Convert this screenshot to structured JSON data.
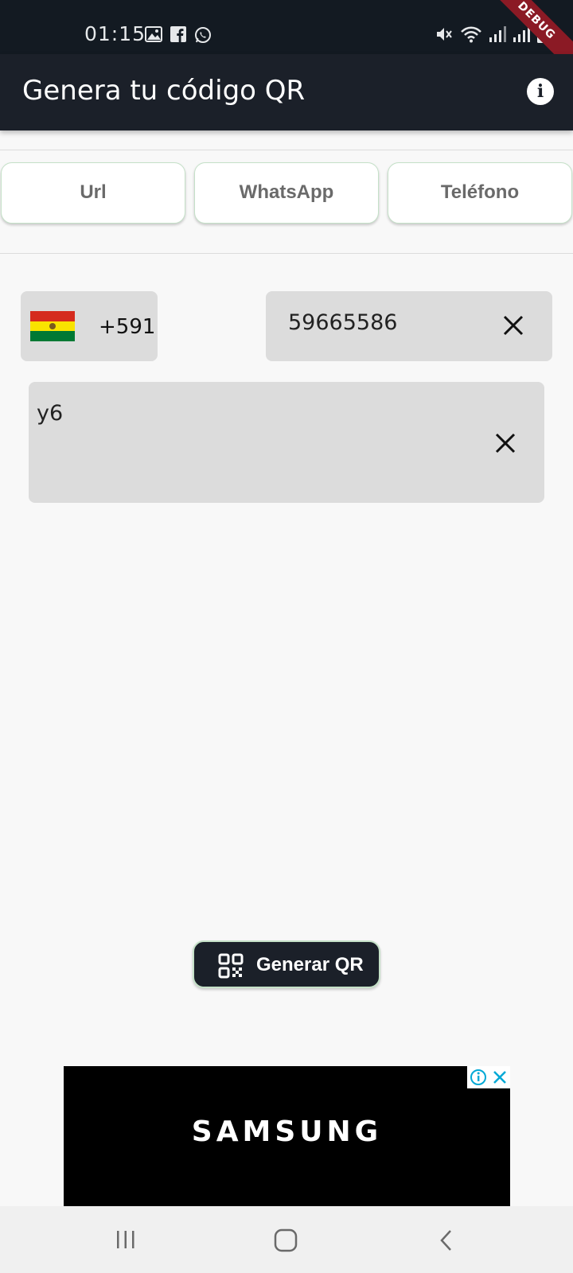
{
  "status_bar": {
    "time": "01:15",
    "left_icons": [
      "image-icon",
      "facebook-icon",
      "whatsapp-icon"
    ],
    "right_icons": [
      "mute-icon",
      "wifi-icon",
      "signal-icon",
      "signal-icon",
      "battery-icon"
    ]
  },
  "debug_banner": "DEBUG",
  "app_bar": {
    "title": "Genera tu código QR",
    "info_icon": "info-icon"
  },
  "tabs": [
    {
      "label": "Url"
    },
    {
      "label": "WhatsApp"
    },
    {
      "label": "Teléfono"
    }
  ],
  "form": {
    "country": {
      "flag": "bolivia-flag",
      "dial_code": "+591"
    },
    "phone": {
      "value": "59665586"
    },
    "message": {
      "value": "y6"
    }
  },
  "generate_button": {
    "label": "Generar QR",
    "icon": "qr-code-icon"
  },
  "ad": {
    "brand": "SAMSUNG"
  },
  "colors": {
    "app_bar": "#1b2029",
    "status_bar": "#131a22",
    "tab_border": "#c5e1c8",
    "field_bg": "#dcdcdc",
    "flag_red": "#d52b1e",
    "flag_yellow": "#f9e300",
    "flag_green": "#007934"
  }
}
